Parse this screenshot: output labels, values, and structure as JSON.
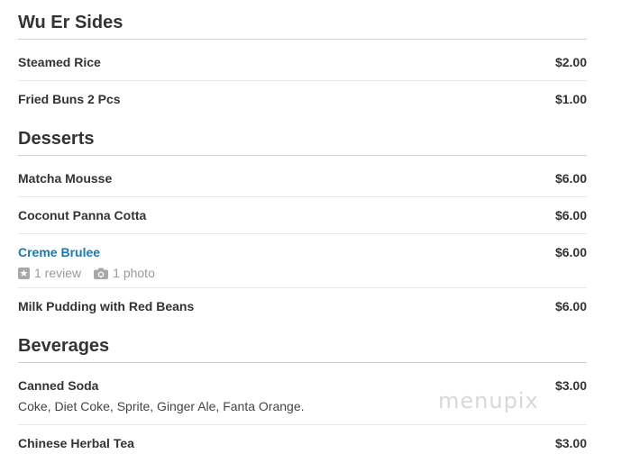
{
  "sections": [
    {
      "title": "Wu Er Sides",
      "items": [
        {
          "name": "Steamed Rice",
          "price": "$2.00"
        },
        {
          "name": "Fried Buns 2 Pcs",
          "price": "$1.00"
        }
      ]
    },
    {
      "title": "Desserts",
      "items": [
        {
          "name": "Matcha Mousse",
          "price": "$6.00"
        },
        {
          "name": "Coconut Panna Cotta",
          "price": "$6.00"
        },
        {
          "name": "Creme Brulee",
          "price": "$6.00",
          "reviews": "1 review",
          "photos": "1 photo"
        },
        {
          "name": "Milk Pudding with Red Beans",
          "price": "$6.00"
        }
      ]
    },
    {
      "title": "Beverages",
      "items": [
        {
          "name": "Canned Soda",
          "price": "$3.00",
          "description": "Coke, Diet Coke, Sprite, Ginger Ale, Fanta Orange."
        },
        {
          "name": "Chinese Herbal Tea",
          "price": "$3.00"
        }
      ]
    }
  ],
  "watermark": "menupix",
  "colors": {
    "link": "#1f7aa8",
    "text": "#333333",
    "muted": "#9a9a9a"
  },
  "icons": {
    "review": "star-square-icon",
    "photo": "camera-icon"
  }
}
